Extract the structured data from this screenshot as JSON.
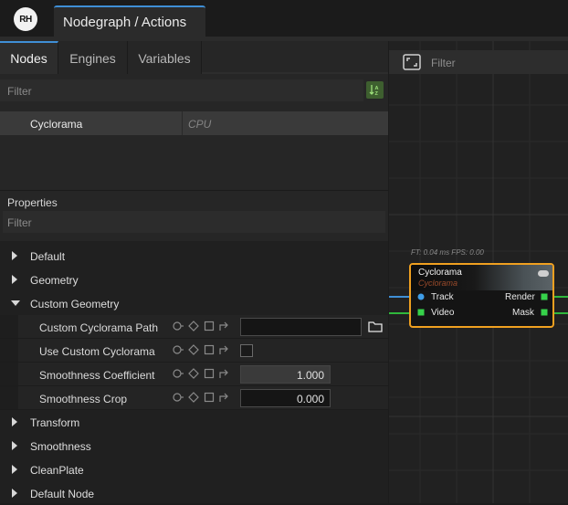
{
  "app": {
    "logo_text": "RH",
    "document_tab": "Nodegraph / Actions"
  },
  "panel_tabs": [
    {
      "label": "Nodes",
      "active": true
    },
    {
      "label": "Engines",
      "active": false
    },
    {
      "label": "Variables",
      "active": false
    }
  ],
  "nodes": {
    "filter_placeholder": "Filter",
    "sort_icon": "sort-az-icon",
    "rows": [
      {
        "name": "Cyclorama",
        "engine": "CPU"
      }
    ]
  },
  "properties": {
    "title": "Properties",
    "filter_placeholder": "Filter",
    "sections_before": [
      "Default",
      "Geometry"
    ],
    "expanded_section": "Custom Geometry",
    "rows": [
      {
        "label": "Custom Cyclorama Path",
        "control": "text",
        "value": ""
      },
      {
        "label": "Use Custom Cyclorama",
        "control": "checkbox",
        "checked": false
      },
      {
        "label": "Smoothness Coefficient",
        "control": "number",
        "value": "1.000",
        "readonly": true
      },
      {
        "label": "Smoothness Crop",
        "control": "number",
        "value": "0.000",
        "readonly": false
      }
    ],
    "sections_after": [
      "Transform",
      "Smoothness",
      "CleanPlate",
      "Default Node"
    ]
  },
  "graph": {
    "filter_placeholder": "Filter",
    "fit_icon": "fit-view-icon",
    "stats": "FT: 0.04 ms FPS: 0.00",
    "node": {
      "title": "Cyclorama",
      "subtitle": "Cyclorama",
      "inputs": [
        "Track",
        "Video"
      ],
      "outputs": [
        "Render",
        "Mask"
      ]
    }
  },
  "colors": {
    "accent": "#3f8fd6",
    "node_border": "#f0a020",
    "port_blue": "#3f9de8",
    "port_green": "#36d24a",
    "wire_green": "#2fb83c",
    "wire_blue": "#3f8fd6"
  }
}
